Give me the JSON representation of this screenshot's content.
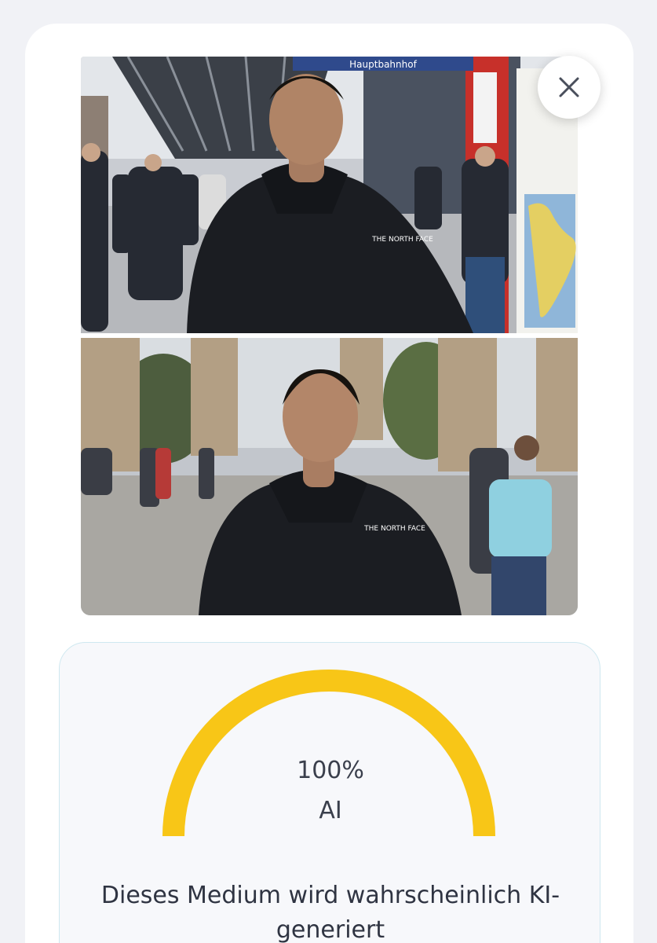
{
  "photos": {
    "top": {
      "sign_text": "Hauptbahnhof",
      "jacket_logo": "THE NORTH FACE"
    },
    "bottom": {
      "jacket_logo": "THE NORTH FACE"
    }
  },
  "close_icon": "close-icon",
  "result": {
    "percent": 100,
    "percent_text": "100%",
    "label": "AI",
    "verdict": "Dieses Medium wird wahrscheinlich KI-generiert",
    "gauge_color": "#f8c617"
  },
  "colors": {
    "background": "#f1f2f6",
    "card": "#ffffff",
    "result_box": "#f7f8fb",
    "result_border": "#cfe8f0"
  }
}
